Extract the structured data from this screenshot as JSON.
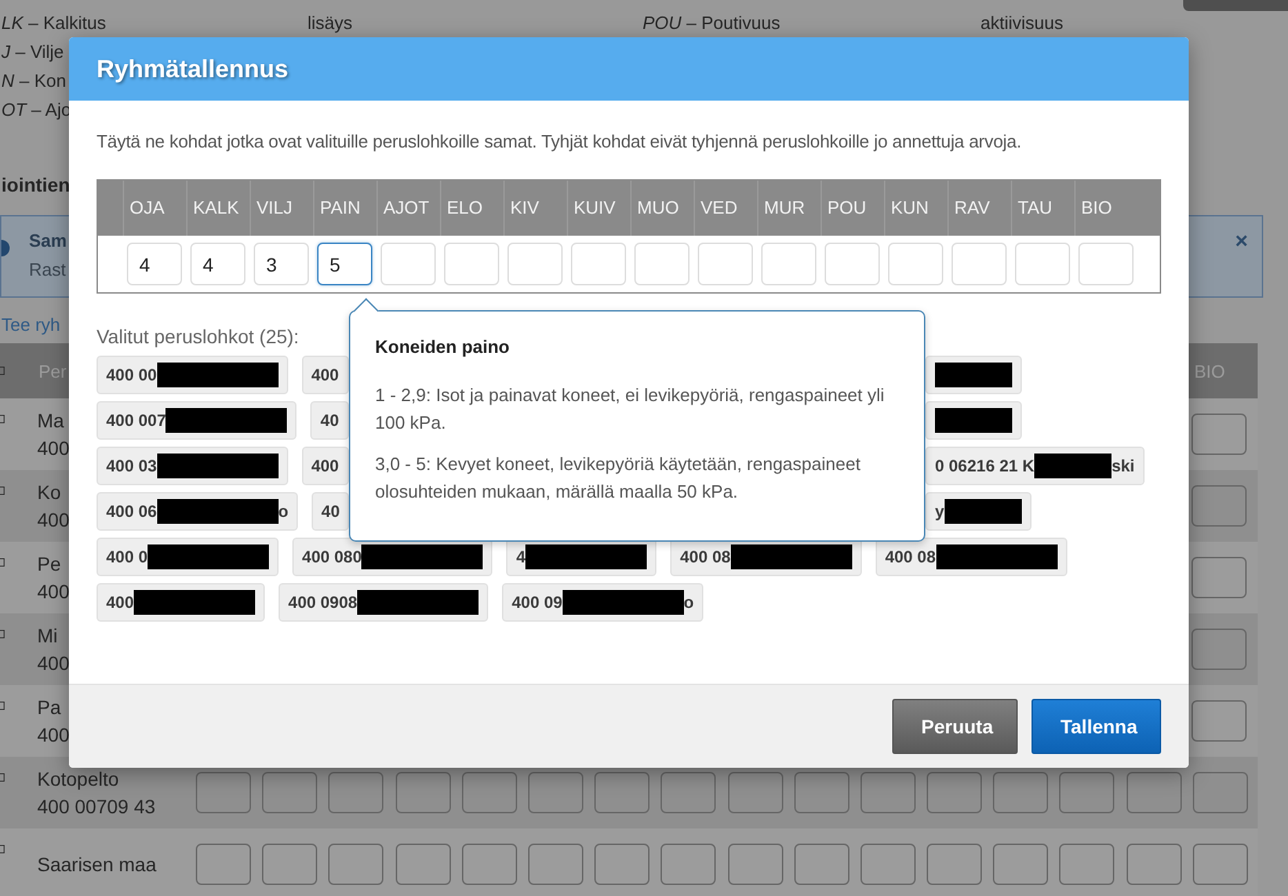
{
  "page": {
    "legend": [
      {
        "lines": [
          "*LK* – Kalkitus",
          "*J* – Vilje",
          "*N* – Kon",
          "*OT* – Ajo"
        ]
      },
      {
        "lines": [
          "lisäys"
        ]
      },
      {
        "lines": [
          "*POU* – Poutivuus"
        ]
      },
      {
        "lines": [
          "aktiivisuus"
        ]
      }
    ],
    "heading": "iointien",
    "alert": {
      "title": "Sam",
      "text": "Rast",
      "close": "×"
    },
    "link": "Tee ryh",
    "table": {
      "columns": [
        "Per",
        "BIO"
      ],
      "rows": [
        {
          "kind": "covered",
          "name": "Ma",
          "code": "400"
        },
        {
          "kind": "covered",
          "name": "Ko",
          "code": "400"
        },
        {
          "kind": "covered",
          "name": "Pe",
          "code": "400"
        },
        {
          "kind": "covered",
          "name": "Mi",
          "code": "400"
        },
        {
          "kind": "covered",
          "name": "Pa",
          "code": "400"
        },
        {
          "kind": "open",
          "name": "Kotopelto",
          "code": "400 00709 43"
        },
        {
          "kind": "open",
          "name": "Saarisen maa"
        }
      ]
    }
  },
  "dialog": {
    "title": "Ryhmätallennus",
    "intro": "Täytä ne kohdat jotka ovat valituille peruslohkoille samat. Tyhjät kohdat eivät tyhjennä peruslohkoille jo annettuja arvoja.",
    "fields": [
      {
        "label": "OJA",
        "value": "4",
        "focused": false
      },
      {
        "label": "KALK",
        "value": "4",
        "focused": false
      },
      {
        "label": "VILJ",
        "value": "3",
        "focused": false
      },
      {
        "label": "PAIN",
        "value": "5",
        "focused": true
      },
      {
        "label": "AJOT",
        "focused": false
      },
      {
        "label": "ELO",
        "focused": false
      },
      {
        "label": "KIV",
        "focused": false
      },
      {
        "label": "KUIV",
        "focused": false
      },
      {
        "label": "MUO",
        "focused": false
      },
      {
        "label": "VED",
        "focused": false
      },
      {
        "label": "MUR",
        "focused": false
      },
      {
        "label": "POU",
        "focused": false
      },
      {
        "label": "KUN",
        "focused": false
      },
      {
        "label": "RAV",
        "focused": false
      },
      {
        "label": "TAU",
        "focused": false
      },
      {
        "label": "BIO",
        "focused": false
      }
    ],
    "selected_label": "Valitut peruslohkot (25):",
    "chip_rows": [
      {
        "kind": "split",
        "left": [
          {
            "text": "400 00",
            "redacted": true
          },
          {
            "text": "400"
          }
        ],
        "right": [
          {
            "redacted": true
          }
        ]
      },
      {
        "kind": "split",
        "left": [
          {
            "text": "400 007",
            "redacted": true
          },
          {
            "text": "40"
          }
        ],
        "right": [
          {
            "redacted": true
          }
        ]
      },
      {
        "kind": "split",
        "left": [
          {
            "text": "400 03",
            "redacted": true
          },
          {
            "text": "400"
          }
        ],
        "right": [
          {
            "text": "0 06216 21 K",
            "redacted": true,
            "suffix": "ski"
          }
        ]
      },
      {
        "kind": "split",
        "left": [
          {
            "text": "400 06",
            "redacted": true,
            "suffix": "o"
          },
          {
            "text": "40"
          }
        ],
        "right": [
          {
            "text": "y",
            "redacted": true
          }
        ]
      },
      {
        "kind": "flow",
        "left": [
          {
            "text": "400 0",
            "redacted": true
          },
          {
            "text": "400 080",
            "redacted": true
          },
          {
            "text": "4",
            "redacted": true
          },
          {
            "text": "400 08",
            "redacted": true
          },
          {
            "text": "400 08",
            "redacted": true
          }
        ]
      },
      {
        "kind": "flow",
        "left": [
          {
            "text": "400",
            "redacted": true
          },
          {
            "text": "400 0908",
            "redacted": true
          },
          {
            "text": "400 09",
            "redacted": true,
            "suffix": "o"
          }
        ]
      }
    ],
    "tooltip": {
      "title": "Koneiden paino",
      "paragraphs": [
        "1 - 2,9: Isot ja painavat koneet, ei levikepyöriä, rengaspaineet yli 100 kPa.",
        "3,0 - 5: Kevyet koneet, levikepyöriä käytetään, rengaspaineet olosuhteiden mukaan, märällä maalla 50 kPa."
      ]
    },
    "buttons": [
      {
        "label": "Peruuta",
        "kind": "secondary"
      },
      {
        "label": "Tallenna",
        "kind": "primary"
      }
    ]
  }
}
